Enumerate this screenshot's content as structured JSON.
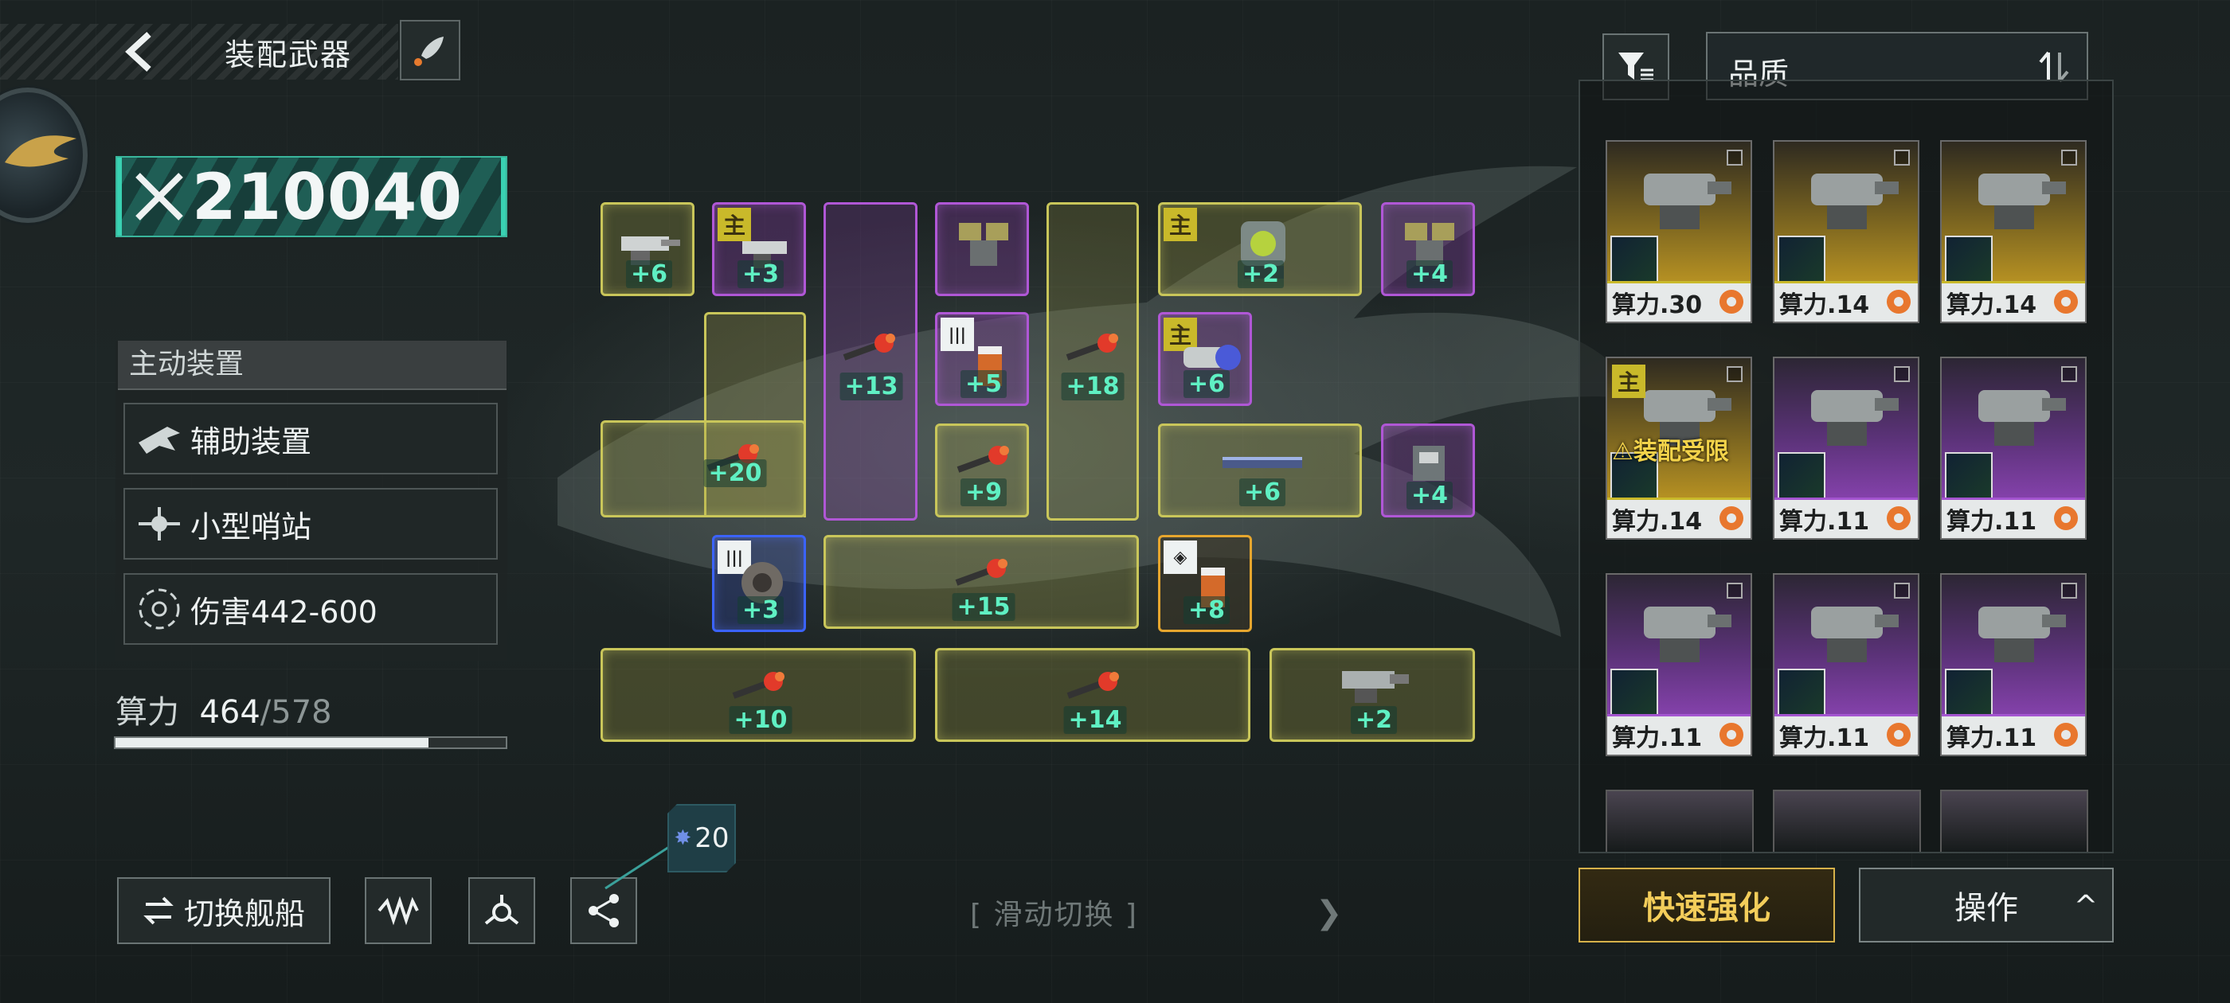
{
  "header": {
    "title": "装配武器"
  },
  "power": {
    "value": "210040"
  },
  "active_devices": {
    "heading": "主动装置",
    "items": [
      {
        "label": "辅助装置"
      },
      {
        "label": "小型哨站"
      },
      {
        "label": "伤害442-600"
      }
    ]
  },
  "compute": {
    "label": "算力",
    "current": "464",
    "max": "/578",
    "fraction": 0.803
  },
  "grid": {
    "slots": [
      {
        "level": "+6"
      },
      {
        "level": "+3",
        "main": "主"
      },
      {
        "level": "+13"
      },
      {
        "level": "+5"
      },
      {
        "level": "+18"
      },
      {
        "level": "+2",
        "main": "主"
      },
      {
        "level": "+4"
      },
      {
        "level": "+6",
        "main": "主"
      },
      {
        "level": "+20"
      },
      {
        "level": "+9"
      },
      {
        "level": "+6"
      },
      {
        "level": "+4"
      },
      {
        "level": "+3"
      },
      {
        "level": "+15"
      },
      {
        "level": "+8"
      },
      {
        "level": "+10"
      },
      {
        "level": "+14"
      },
      {
        "level": "+2"
      }
    ]
  },
  "sort": {
    "label": "品质"
  },
  "inventory": [
    {
      "cost": "算力.30",
      "tier": "gold"
    },
    {
      "cost": "算力.14",
      "tier": "gold"
    },
    {
      "cost": "算力.14",
      "tier": "gold"
    },
    {
      "cost": "算力.14",
      "tier": "gold",
      "main": "主",
      "warning": "装配受限"
    },
    {
      "cost": "算力.11",
      "tier": "purple"
    },
    {
      "cost": "算力.11",
      "tier": "purple"
    },
    {
      "cost": "算力.11",
      "tier": "purple"
    },
    {
      "cost": "算力.11",
      "tier": "purple"
    },
    {
      "cost": "算力.11",
      "tier": "purple"
    }
  ],
  "buttons": {
    "quick_upgrade": "快速强化",
    "operate": "操作",
    "switch_ship": "切换舰船"
  },
  "badge": {
    "value": "20"
  },
  "slide_hint": "[ 滑动切换 ]",
  "colors": {
    "gold": "#c9b92a",
    "purple": "#a455d0",
    "teal": "#39d1b2",
    "level_green": "#5ff0c3"
  }
}
